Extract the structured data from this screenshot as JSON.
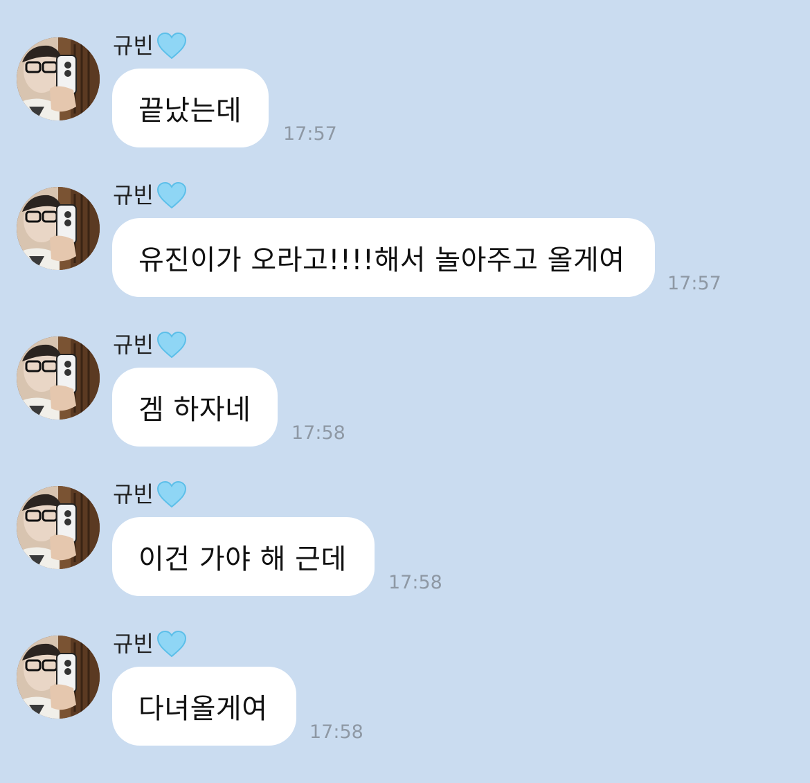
{
  "chat": {
    "messages": [
      {
        "sender": "규빈",
        "sender_icon": "blue-heart-icon",
        "text": "끝났는데",
        "time": "17:57"
      },
      {
        "sender": "규빈",
        "sender_icon": "blue-heart-icon",
        "text": "유진이가 오라고!!!!해서 놀아주고 올게여",
        "time": "17:57"
      },
      {
        "sender": "규빈",
        "sender_icon": "blue-heart-icon",
        "text": "겜 하자네",
        "time": "17:58"
      },
      {
        "sender": "규빈",
        "sender_icon": "blue-heart-icon",
        "text": "이건 가야 해 근데",
        "time": "17:58"
      },
      {
        "sender": "규빈",
        "sender_icon": "blue-heart-icon",
        "text": "다녀올게여",
        "time": "17:58"
      }
    ]
  },
  "colors": {
    "background": "#cadcf0",
    "bubble": "#ffffff",
    "timestamp": "#8e98a4",
    "heart": "#8fd6f5"
  }
}
